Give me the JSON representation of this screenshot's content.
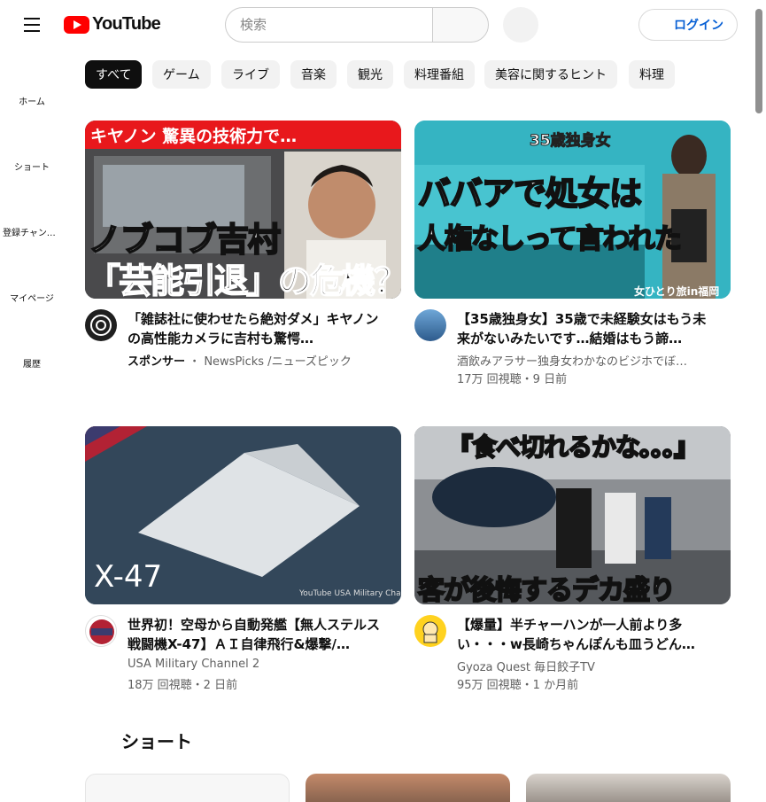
{
  "header": {
    "logo_text": "YouTube",
    "search_placeholder": "検索",
    "login_label": "ログイン"
  },
  "sidebar": {
    "items": [
      {
        "label": "ホーム"
      },
      {
        "label": "ショート"
      },
      {
        "label": "登録チャンネル"
      },
      {
        "label": "マイページ"
      },
      {
        "label": "履歴"
      }
    ]
  },
  "chips": [
    "すべて",
    "ゲーム",
    "ライブ",
    "音楽",
    "観光",
    "料理番組",
    "美容に関するヒント",
    "料理"
  ],
  "videos": [
    {
      "title": "「雑誌社に使わせたら絶対ダメ」キヤノンの高性能カメラに吉村も驚愕…",
      "sponsor": "スポンサー",
      "channel": "NewsPicks /ニューズピック",
      "stats": "",
      "thumb_text": {
        "top": "キヤノン 驚異の技術力で…",
        "mid": "ノブコブ吉村",
        "bottom": "「芸能引退」の危機？"
      }
    },
    {
      "title": "【35歳独身女】35歳で未経験女はもう未来がないみたいです…結婚はもう諦…",
      "channel": "酒飲みアラサー独身女わかなのビジホでぼ…",
      "stats": "17万 回視聴・9 日前",
      "thumb_text": {
        "top": "35歳独身女",
        "mid": "ババアで処女は",
        "bottom": "人権なしって言われた",
        "corner": "女ひとり旅in福岡"
      }
    },
    {
      "title": "世界初！空母から自動発艦【無人ステルス戦闘機X-47】ＡＩ自律飛行&爆撃/…",
      "channel": "USA Military Channel 2",
      "stats": "18万 回視聴・2 日前",
      "thumb_text": {
        "label": "X-47",
        "watermark": "YouTube USA Military Channel"
      }
    },
    {
      "title": "【爆量】半チャーハンが一人前より多い・・・w長崎ちゃんぽんも皿うどん…",
      "channel": "Gyoza Quest 毎日餃子TV",
      "stats": "95万 回視聴・1 か月前",
      "thumb_text": {
        "top": "『食べ切れるかな。。。』",
        "bottom": "客が後悔するデカ盛り"
      }
    }
  ],
  "shorts": {
    "heading": "ショート"
  },
  "colors": {
    "accent_red": "#ff0000",
    "login_blue": "#065fd4",
    "chip_active": "#0f0f0f",
    "chip_bg": "#f2f2f2"
  }
}
